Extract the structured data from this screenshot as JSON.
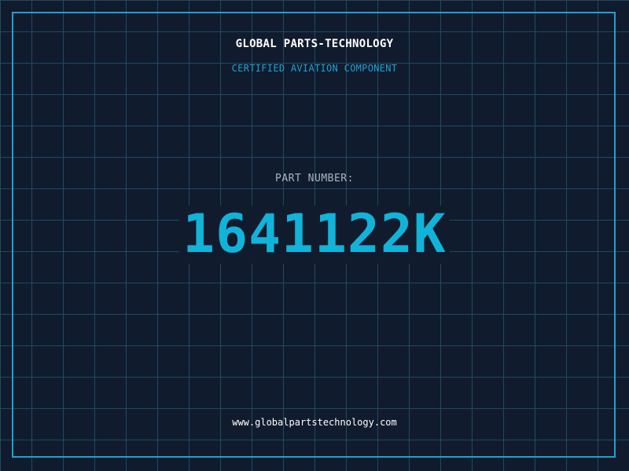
{
  "header": {
    "title": "GLOBAL PARTS-TECHNOLOGY",
    "subtitle": "CERTIFIED AVIATION COMPONENT"
  },
  "part": {
    "label": "PART NUMBER:",
    "number": "1641122K"
  },
  "footer": {
    "website": "www.globalpartstechnology.com"
  },
  "colors": {
    "background": "#111b2e",
    "grid": "#1f4a63",
    "accent": "#1aa3cf",
    "part_number": "#12b3d8",
    "label": "#a7b6c6",
    "text": "#ffffff"
  }
}
